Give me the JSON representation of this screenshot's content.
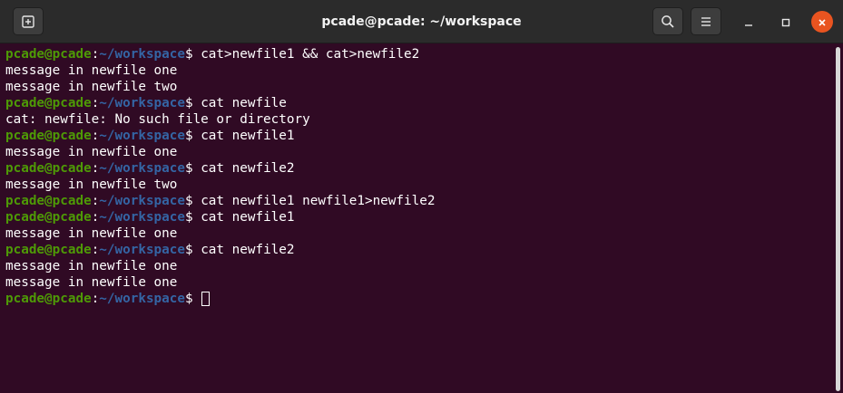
{
  "window": {
    "title": "pcade@pcade: ~/workspace"
  },
  "titlebar": {
    "new_tab_icon": "new-tab-icon",
    "search_icon": "search-icon",
    "menu_icon": "hamburger-menu-icon",
    "minimize_icon": "minimize-icon",
    "maximize_icon": "maximize-icon",
    "close_icon": "close-icon"
  },
  "colors": {
    "terminal_bg": "#300a24",
    "prompt_user": "#4e9a06",
    "prompt_path": "#3465a4",
    "close_button": "#e95420",
    "titlebar_bg": "#2b2b2b"
  },
  "prompt": {
    "user": "pcade@pcade",
    "sep": ":",
    "path": "~/workspace",
    "symbol": "$ "
  },
  "terminal": {
    "lines": [
      {
        "type": "cmd",
        "text": "cat>newfile1 && cat>newfile2"
      },
      {
        "type": "out",
        "text": "message in newfile one"
      },
      {
        "type": "out",
        "text": "message in newfile two"
      },
      {
        "type": "cmd",
        "text": "cat newfile"
      },
      {
        "type": "out",
        "text": "cat: newfile: No such file or directory"
      },
      {
        "type": "cmd",
        "text": "cat newfile1"
      },
      {
        "type": "out",
        "text": "message in newfile one"
      },
      {
        "type": "cmd",
        "text": "cat newfile2"
      },
      {
        "type": "out",
        "text": "message in newfile two"
      },
      {
        "type": "cmd",
        "text": "cat newfile1 newfile1>newfile2"
      },
      {
        "type": "cmd",
        "text": "cat newfile1"
      },
      {
        "type": "out",
        "text": "message in newfile one"
      },
      {
        "type": "cmd",
        "text": "cat newfile2"
      },
      {
        "type": "out",
        "text": "message in newfile one"
      },
      {
        "type": "out",
        "text": "message in newfile one"
      },
      {
        "type": "cmd",
        "text": "",
        "cursor": true
      }
    ]
  }
}
